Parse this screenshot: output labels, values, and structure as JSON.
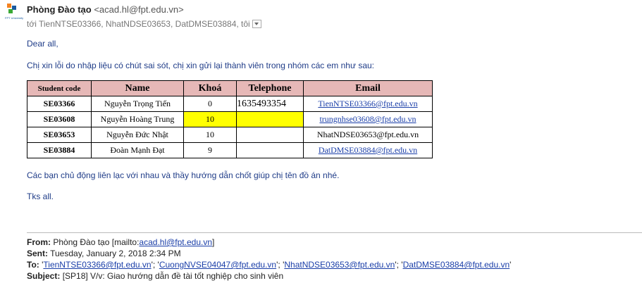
{
  "sender": {
    "name": "Phòng Đào tạo",
    "address": "<acad.hl@fpt.edu.vn>",
    "logo_caption": "FPT University"
  },
  "recipients": "tới TienNTSE03366, NhatNDSE03653, DatDMSE03884, tôi",
  "body": {
    "greeting": "Dear all,",
    "intro": "Chị xin lỗi do nhập liệu có chút sai sót, chị xin gửi lại thành viên trong nhóm các em như sau:",
    "followup": "Các bạn chủ động liên lạc với nhau và thầy hướng dẫn chốt giúp chị tên đồ án nhé.",
    "closing": "Tks all."
  },
  "table": {
    "headers": [
      "Student code",
      "Name",
      "Khoá",
      "Telephone",
      "Email"
    ],
    "rows": [
      {
        "code": "SE03366",
        "name": "Nguyễn Trọng Tiến",
        "khoa": "0",
        "tel": "1635493354",
        "email": "TienNTSE03366@fpt.edu.vn"
      },
      {
        "code": "SE03608",
        "name": "Nguyễn Hoàng Trung",
        "khoa": "10",
        "tel": "",
        "email": "trungnhse03608@fpt.edu.vn"
      },
      {
        "code": "SE03653",
        "name": "Nguyễn Đức Nhật",
        "khoa": "10",
        "tel": "",
        "email": "NhatNDSE03653@fpt.edu.vn"
      },
      {
        "code": "SE03884",
        "name": "Đoàn Mạnh Đạt",
        "khoa": "9",
        "tel": "",
        "email": "DatDMSE03884@fpt.edu.vn"
      }
    ]
  },
  "quoted": {
    "from_label": "From:",
    "from_value": "Phòng Đào tạo [mailto:",
    "from_link": "acad.hl@fpt.edu.vn",
    "from_end": "]",
    "sent_label": "Sent:",
    "sent_value": "Tuesday, January 2, 2018 2:34 PM",
    "to_label": "To:",
    "to": [
      "TienNTSE03366@fpt.edu.vn",
      "CuongNVSE04047@fpt.edu.vn",
      "NhatNDSE03653@fpt.edu.vn",
      "DatDMSE03884@fpt.edu.vn"
    ],
    "subject_label": "Subject:",
    "subject_value": "[SP18] V/v: Giao hướng dẫn đề tài tốt nghiệp cho sinh viên"
  },
  "colors": {
    "header_bg": "#e6b8b7",
    "highlight": "#ffff00",
    "body_text": "#1f3c88",
    "link": "#1a3ea8"
  }
}
